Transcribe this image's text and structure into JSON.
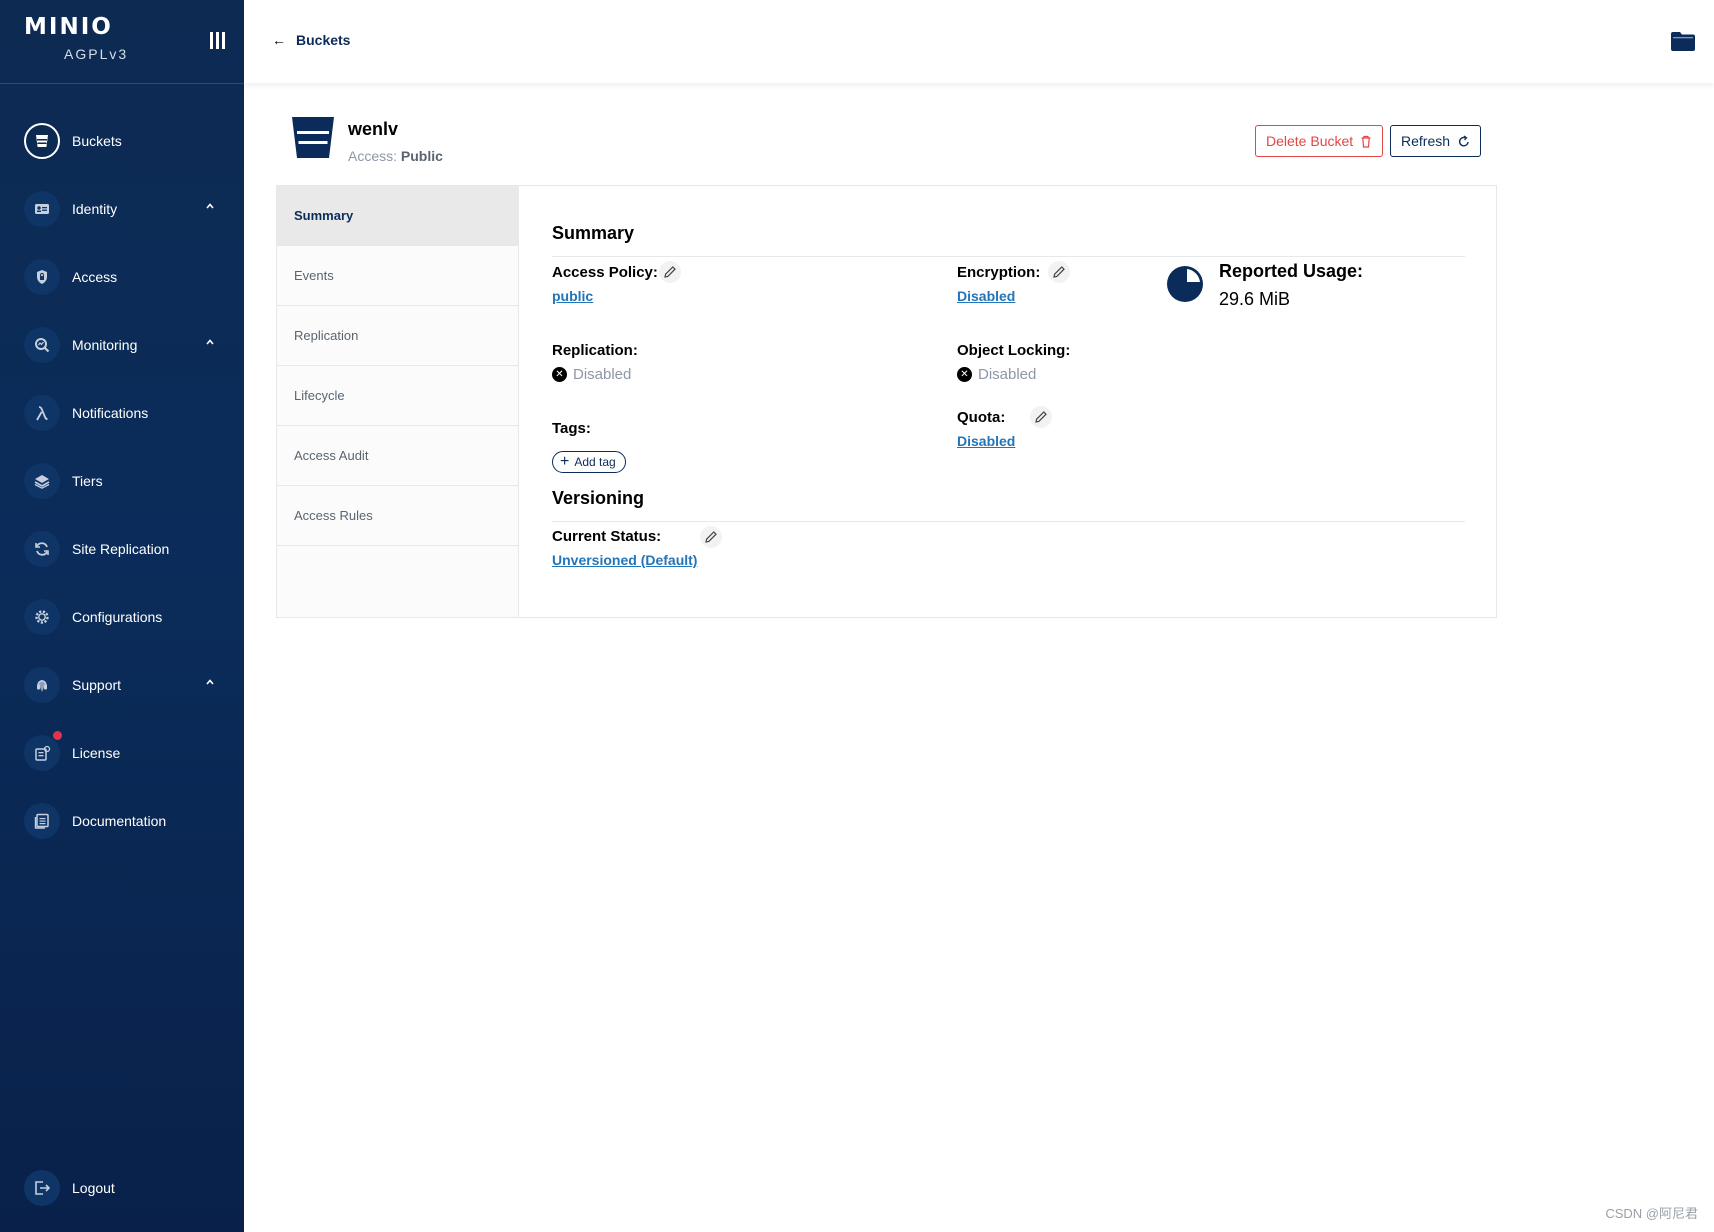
{
  "sidebar": {
    "brand": "MINIO",
    "license_type": "AGPLv3",
    "items": [
      {
        "label": "Buckets",
        "icon": "bucket-icon"
      },
      {
        "label": "Identity",
        "icon": "identity-icon"
      },
      {
        "label": "Access",
        "icon": "lock-icon"
      },
      {
        "label": "Monitoring",
        "icon": "monitoring-icon"
      },
      {
        "label": "Notifications",
        "icon": "lambda-icon"
      },
      {
        "label": "Tiers",
        "icon": "layers-icon"
      },
      {
        "label": "Site Replication",
        "icon": "sync-icon"
      },
      {
        "label": "Configurations",
        "icon": "gear-icon"
      },
      {
        "label": "Support",
        "icon": "support-icon"
      },
      {
        "label": "License",
        "icon": "license-icon"
      },
      {
        "label": "Documentation",
        "icon": "documentation-icon"
      }
    ],
    "logout": "Logout"
  },
  "header": {
    "back_label": "Buckets"
  },
  "bucket": {
    "name": "wenlv",
    "access_prefix": "Access:",
    "access_value": "Public",
    "delete_label": "Delete Bucket",
    "refresh_label": "Refresh"
  },
  "tabs": [
    "Summary",
    "Events",
    "Replication",
    "Lifecycle",
    "Access Audit",
    "Access Rules"
  ],
  "summary": {
    "title": "Summary",
    "access_policy_label": "Access Policy:",
    "access_policy_value": "public",
    "encryption_label": "Encryption:",
    "encryption_value": "Disabled",
    "reported_usage_label": "Reported Usage:",
    "reported_usage_value": "29.6 MiB",
    "replication_label": "Replication:",
    "replication_value": "Disabled",
    "object_locking_label": "Object Locking:",
    "object_locking_value": "Disabled",
    "tags_label": "Tags:",
    "add_tag_label": "Add tag",
    "quota_label": "Quota:",
    "quota_value": "Disabled"
  },
  "versioning": {
    "title": "Versioning",
    "current_status_label": "Current Status:",
    "current_status_value": "Unversioned (Default)"
  },
  "watermark": "CSDN @阿尼君",
  "colors": {
    "sidebar_bg": "#0b2c5a",
    "accent": "#0b2c5a",
    "link": "#2275b8",
    "danger": "#e04747",
    "notification_dot": "#e3344f"
  }
}
